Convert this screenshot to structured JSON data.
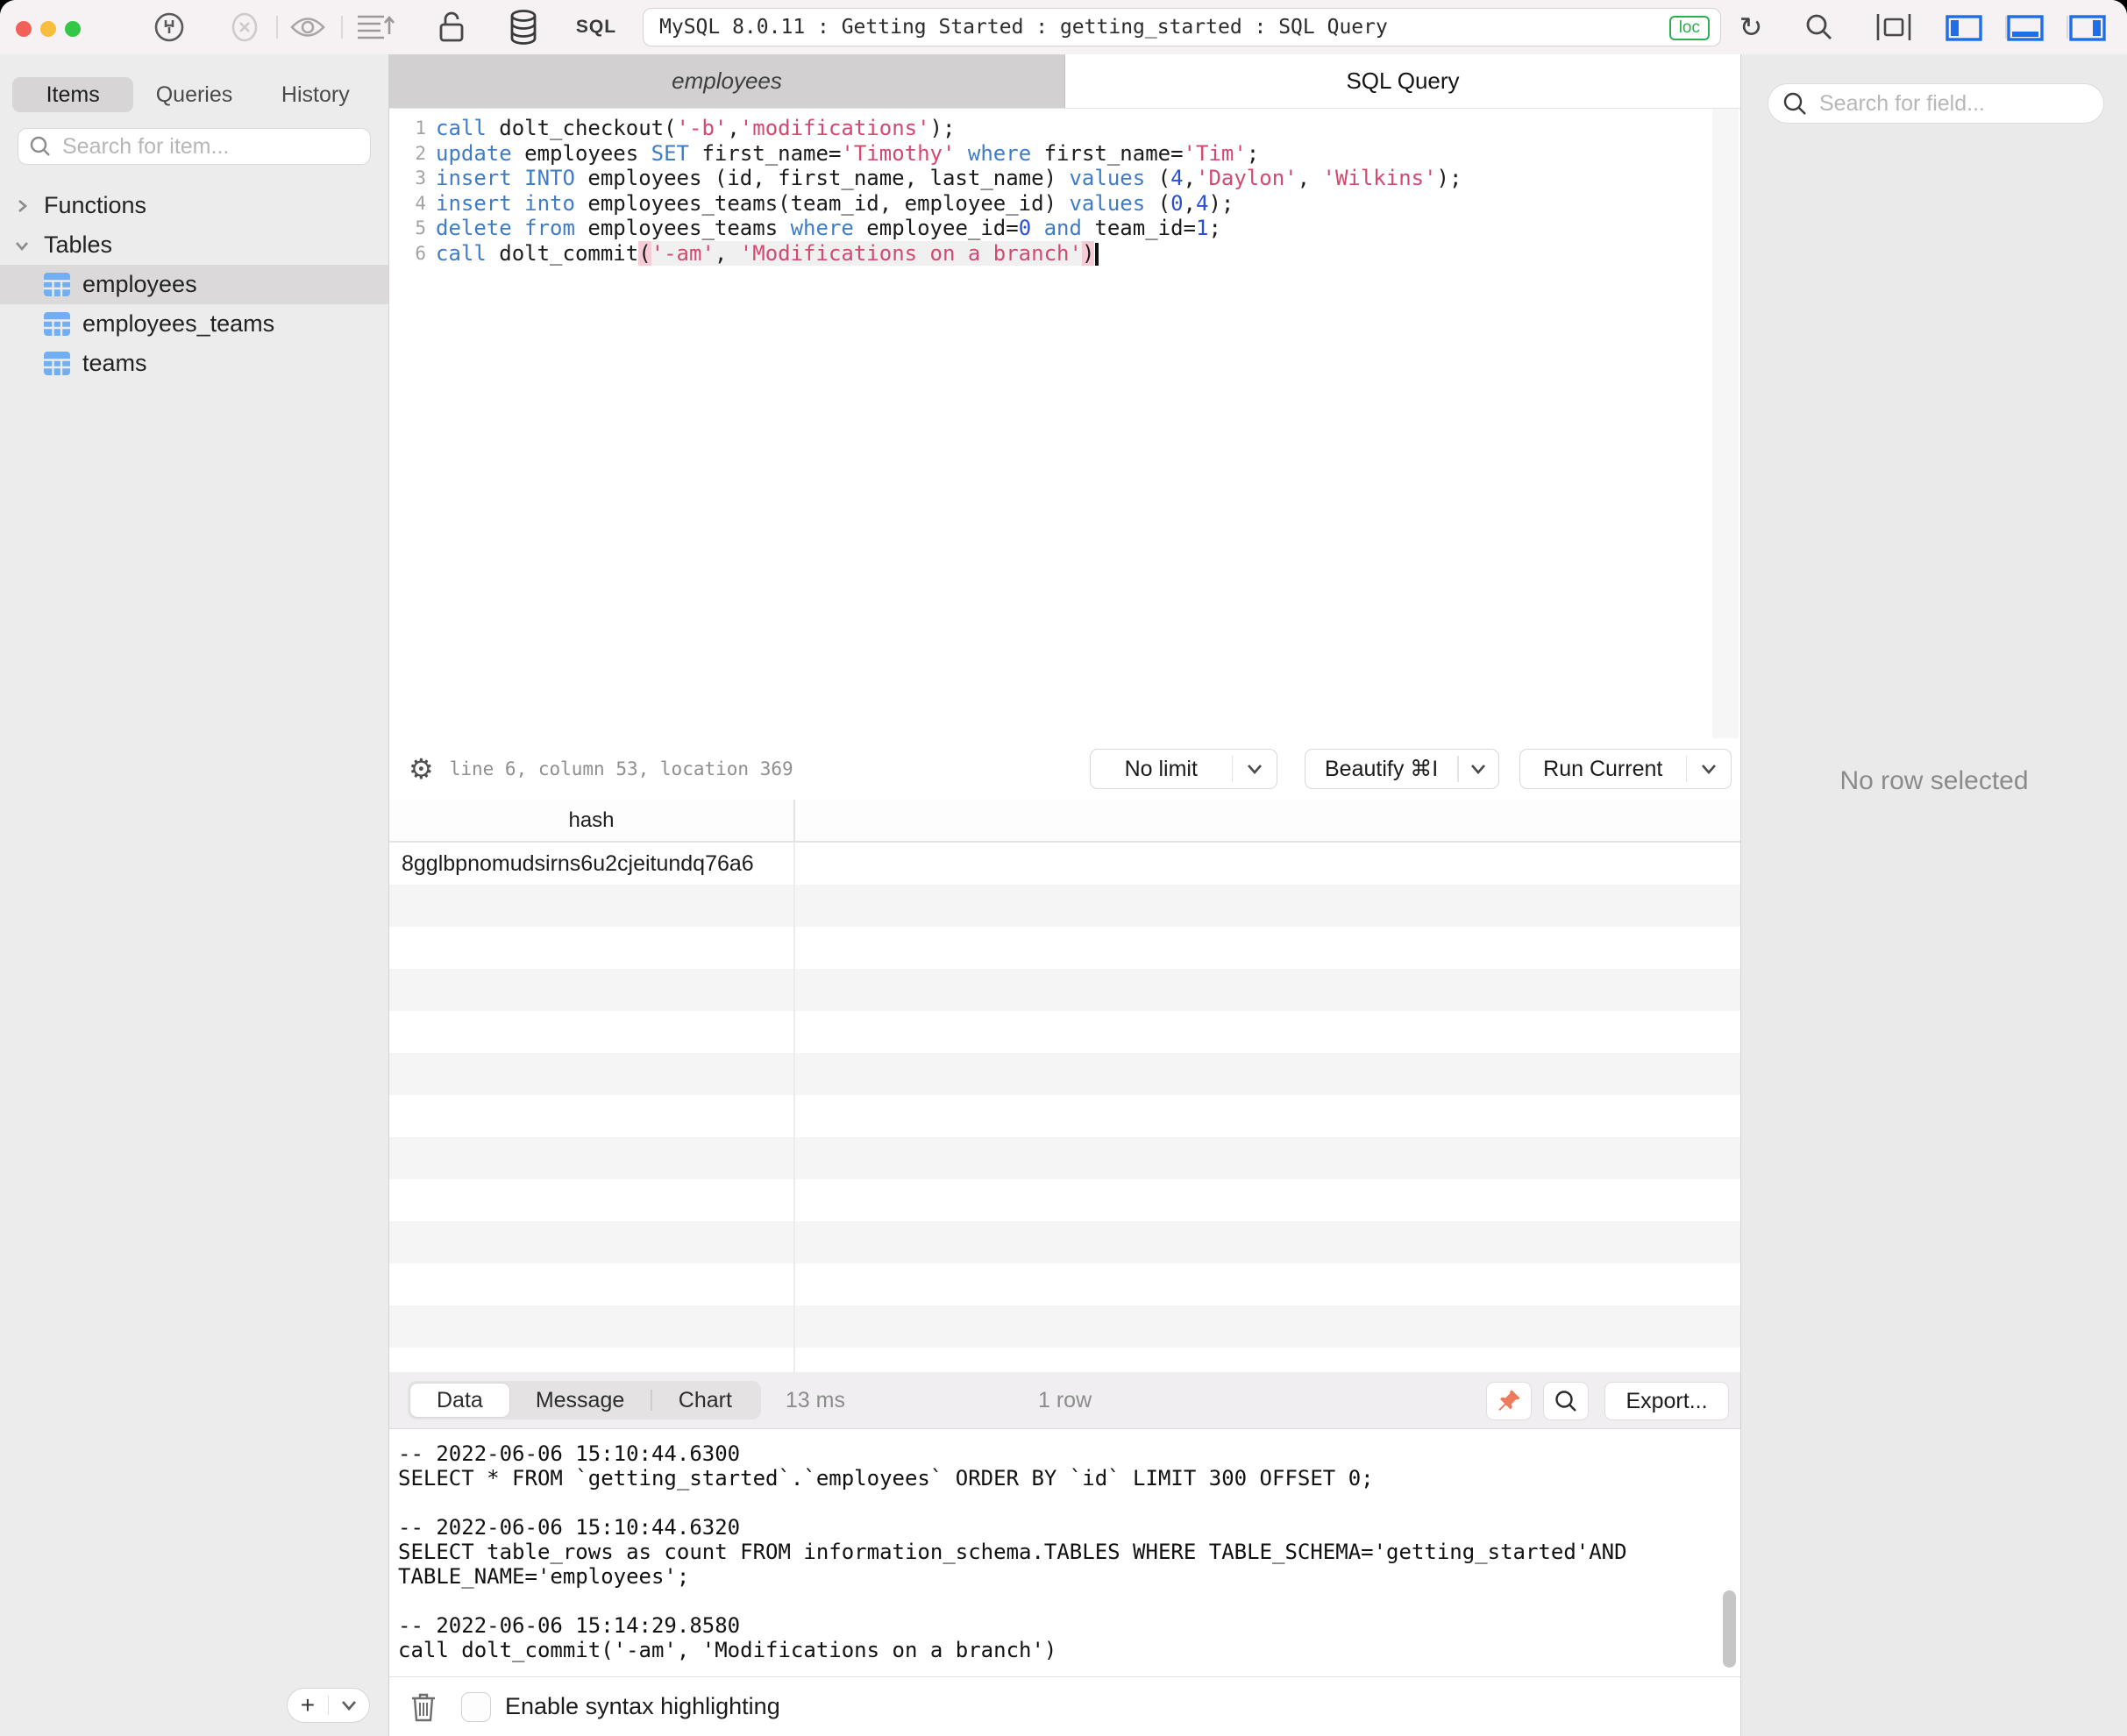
{
  "window": {
    "title": "MySQL 8.0.11 : Getting Started : getting_started : SQL Query",
    "connection_badge": "loc",
    "sql_label": "SQL",
    "toolbar_icons": [
      "power-plug",
      "disconnect-circle",
      "eye",
      "structure-sort",
      "lock",
      "database",
      "refresh",
      "search",
      "layout-frame",
      "toggle-left-panel",
      "toggle-bottom-panel",
      "toggle-right-panel"
    ]
  },
  "sidebar": {
    "tabs": [
      {
        "label": "Items",
        "active": true
      },
      {
        "label": "Queries",
        "active": false
      },
      {
        "label": "History",
        "active": false
      }
    ],
    "search_placeholder": "Search for item...",
    "tree": {
      "functions_label": "Functions",
      "tables_label": "Tables",
      "tables": [
        {
          "name": "employees",
          "selected": true
        },
        {
          "name": "employees_teams",
          "selected": false
        },
        {
          "name": "teams",
          "selected": false
        }
      ]
    },
    "add_button_label": "+"
  },
  "editor": {
    "tabs": [
      {
        "label": "employees",
        "active": false
      },
      {
        "label": "SQL Query",
        "active": true
      }
    ],
    "lines": [
      {
        "num": "1",
        "tokens": [
          [
            "tk-kw",
            "call"
          ],
          [
            "tk-pl",
            " dolt_checkout("
          ],
          [
            "tk-str",
            "'-b'"
          ],
          [
            "tk-pl",
            ","
          ],
          [
            "tk-str",
            "'modifications'"
          ],
          [
            "tk-pl",
            ");"
          ]
        ]
      },
      {
        "num": "2",
        "tokens": [
          [
            "tk-kw",
            "update"
          ],
          [
            "tk-pl",
            " employees "
          ],
          [
            "tk-kw",
            "SET"
          ],
          [
            "tk-pl",
            " first_name="
          ],
          [
            "tk-str",
            "'Timothy'"
          ],
          [
            "tk-pl",
            " "
          ],
          [
            "tk-kw",
            "where"
          ],
          [
            "tk-pl",
            " first_name="
          ],
          [
            "tk-str",
            "'Tim'"
          ],
          [
            "tk-pl",
            ";"
          ]
        ]
      },
      {
        "num": "3",
        "tokens": [
          [
            "tk-kw",
            "insert"
          ],
          [
            "tk-pl",
            " "
          ],
          [
            "tk-kw",
            "INTO"
          ],
          [
            "tk-pl",
            " employees (id, first_name, last_name) "
          ],
          [
            "tk-kw",
            "values"
          ],
          [
            "tk-pl",
            " ("
          ],
          [
            "tk-num",
            "4"
          ],
          [
            "tk-pl",
            ","
          ],
          [
            "tk-str",
            "'Daylon'"
          ],
          [
            "tk-pl",
            ", "
          ],
          [
            "tk-str",
            "'Wilkins'"
          ],
          [
            "tk-pl",
            ");"
          ]
        ]
      },
      {
        "num": "4",
        "tokens": [
          [
            "tk-kw",
            "insert"
          ],
          [
            "tk-pl",
            " "
          ],
          [
            "tk-kw",
            "into"
          ],
          [
            "tk-pl",
            " employees_teams(team_id, employee_id) "
          ],
          [
            "tk-kw",
            "values"
          ],
          [
            "tk-pl",
            " ("
          ],
          [
            "tk-num",
            "0"
          ],
          [
            "tk-pl",
            ","
          ],
          [
            "tk-num",
            "4"
          ],
          [
            "tk-pl",
            ");"
          ]
        ]
      },
      {
        "num": "5",
        "tokens": [
          [
            "tk-kw",
            "delete"
          ],
          [
            "tk-pl",
            " "
          ],
          [
            "tk-kw",
            "from"
          ],
          [
            "tk-pl",
            " employees_teams "
          ],
          [
            "tk-kw",
            "where"
          ],
          [
            "tk-pl",
            " employee_id="
          ],
          [
            "tk-num",
            "0"
          ],
          [
            "tk-pl",
            " "
          ],
          [
            "tk-kw",
            "and"
          ],
          [
            "tk-pl",
            " team_id="
          ],
          [
            "tk-num",
            "1"
          ],
          [
            "tk-pl",
            ";"
          ]
        ]
      },
      {
        "num": "6",
        "cursor": true,
        "tokens": [
          [
            "tk-kw",
            "call"
          ],
          [
            "tk-pl",
            " dolt_commit"
          ],
          [
            "tk-pl tk-paren",
            "("
          ],
          [
            "tk-str tk-rgn",
            "'-am'"
          ],
          [
            "tk-pl tk-rgn",
            ", "
          ],
          [
            "tk-str tk-rgn",
            "'Modifications on a branch'"
          ],
          [
            "tk-pl tk-paren",
            ")"
          ]
        ]
      }
    ],
    "status_position": "line 6, column 53, location 369",
    "buttons": [
      {
        "label": "No limit"
      },
      {
        "label": "Beautify ⌘I"
      },
      {
        "label": "Run Current"
      }
    ]
  },
  "results": {
    "columns": [
      "hash",
      ""
    ],
    "rows": [
      [
        "8gglbpnomudsirns6u2cjeitundq76a6",
        ""
      ]
    ],
    "empty_row_count": 12,
    "tabs": [
      {
        "label": "Data",
        "active": true
      },
      {
        "label": "Message",
        "active": false
      },
      {
        "label": "Chart",
        "active": false
      }
    ],
    "elapsed": "13 ms",
    "row_count": "1 row",
    "export_label": "Export..."
  },
  "log": {
    "lines": [
      "-- 2022-06-06 15:10:44.6300",
      "SELECT * FROM `getting_started`.`employees` ORDER BY `id` LIMIT 300 OFFSET 0;",
      "",
      "-- 2022-06-06 15:10:44.6320",
      "SELECT table_rows as count FROM information_schema.TABLES WHERE TABLE_SCHEMA='getting_started'AND",
      "TABLE_NAME='employees';",
      "",
      "-- 2022-06-06 15:14:29.8580",
      "call dolt_commit('-am', 'Modifications on a branch')"
    ]
  },
  "footer": {
    "syntax_checkbox_label": "Enable syntax highlighting",
    "syntax_checked": false
  },
  "right_panel": {
    "search_placeholder": "Search for field...",
    "empty_text": "No row selected"
  },
  "colors": {
    "accent_blue": "#1e6ee8",
    "keyword_blue": "#3f7cc6",
    "string_pink": "#d3496f",
    "number_blue": "#2b50d8",
    "loc_green": "#2eae4f",
    "pin_orange": "#ee7a5e"
  }
}
